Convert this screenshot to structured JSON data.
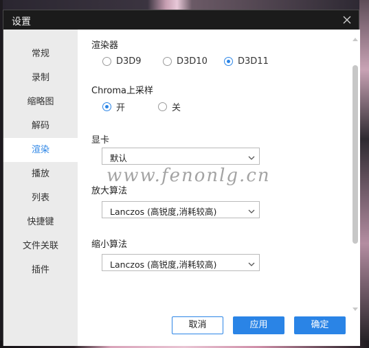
{
  "window": {
    "title": "设置"
  },
  "sidebar": {
    "items": [
      {
        "label": "常规"
      },
      {
        "label": "录制"
      },
      {
        "label": "缩略图"
      },
      {
        "label": "解码"
      },
      {
        "label": "渲染",
        "active": true
      },
      {
        "label": "播放"
      },
      {
        "label": "列表"
      },
      {
        "label": "快捷键"
      },
      {
        "label": "文件关联"
      },
      {
        "label": "插件"
      }
    ]
  },
  "renderer": {
    "title": "渲染器",
    "options": [
      "D3D9",
      "D3D10",
      "D3D11"
    ],
    "selected": "D3D11"
  },
  "chroma": {
    "title": "Chroma上采样",
    "options": [
      "开",
      "关"
    ],
    "selected": "开"
  },
  "gpu": {
    "title": "显卡",
    "value": "默认"
  },
  "upscale": {
    "title": "放大算法",
    "value": "Lanczos (高锐度,消耗较高)"
  },
  "downscale": {
    "title": "缩小算法",
    "value": "Lanczos (高锐度,消耗较高)"
  },
  "watermark": "www.fenonlg.cn",
  "buttons": {
    "cancel": "取消",
    "apply": "应用",
    "ok": "确定"
  },
  "colors": {
    "accent": "#2a84e6",
    "titlebar": "#1b1b1b",
    "sidebar": "#ebebeb"
  }
}
